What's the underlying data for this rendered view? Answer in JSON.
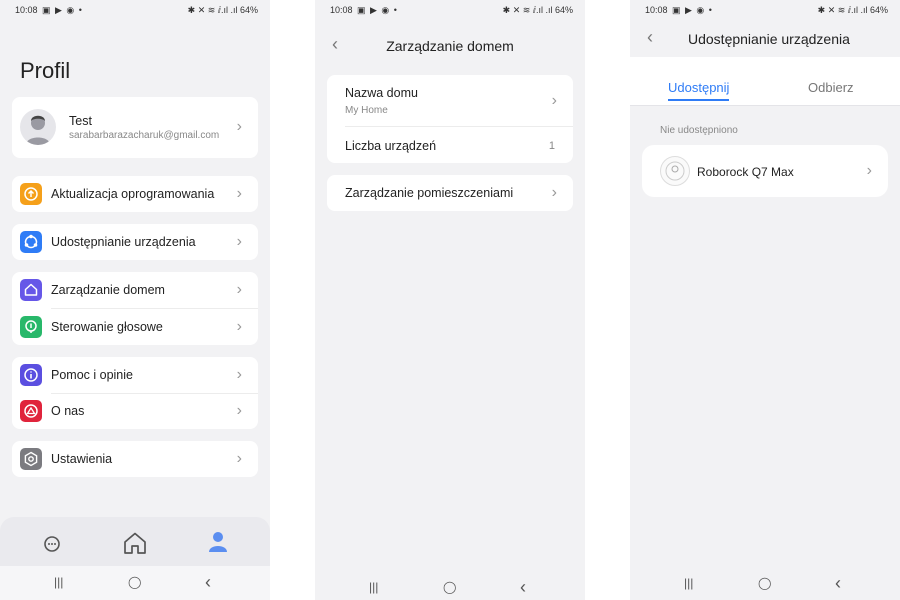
{
  "status": {
    "time": "10:08",
    "battery": "64%",
    "signal_text": "✱ ✕ ≋ ⅈ.ıl .ıl",
    "left_icons": "▣ ▶ ◉ •"
  },
  "navbar": {
    "recents": "|||",
    "home": "◯",
    "back": "‹"
  },
  "screen1": {
    "title": "Profil",
    "profile": {
      "name": "Test",
      "email": "sarabarbarazacharuk@gmail.com"
    },
    "menu": [
      {
        "label": "Aktualizacja oprogramowania",
        "icon": "update-icon",
        "color": "#f5a01a"
      },
      {
        "label": "Udostępnianie urządzenia",
        "icon": "share-icon",
        "color": "#2f7cf6"
      },
      {
        "label": "Zarządzanie domem",
        "icon": "home-icon",
        "color": "#6657e8"
      },
      {
        "label": "Sterowanie głosowe",
        "icon": "voice-icon",
        "color": "#28b86a"
      },
      {
        "label": "Pomoc i opinie",
        "icon": "help-icon",
        "color": "#5b4fe0"
      },
      {
        "label": "O nas",
        "icon": "about-icon",
        "color": "#e0243c"
      },
      {
        "label": "Ustawienia",
        "icon": "settings-icon",
        "color": "#7b7b80"
      }
    ],
    "tabs": [
      "chat-icon",
      "home-icon",
      "profile-icon"
    ]
  },
  "screen2": {
    "title": "Zarządzanie domem",
    "home_name_label": "Nazwa domu",
    "home_name_value": "My Home",
    "device_count_label": "Liczba urządzeń",
    "device_count_value": "1",
    "rooms_label": "Zarządzanie pomieszczeniami"
  },
  "screen3": {
    "title": "Udostępnianie urządzenia",
    "tab_share": "Udostępnij",
    "tab_receive": "Odbierz",
    "section_label": "Nie udostępniono",
    "device_name": "Roborock Q7 Max",
    "accent": "#2f7cf6"
  }
}
